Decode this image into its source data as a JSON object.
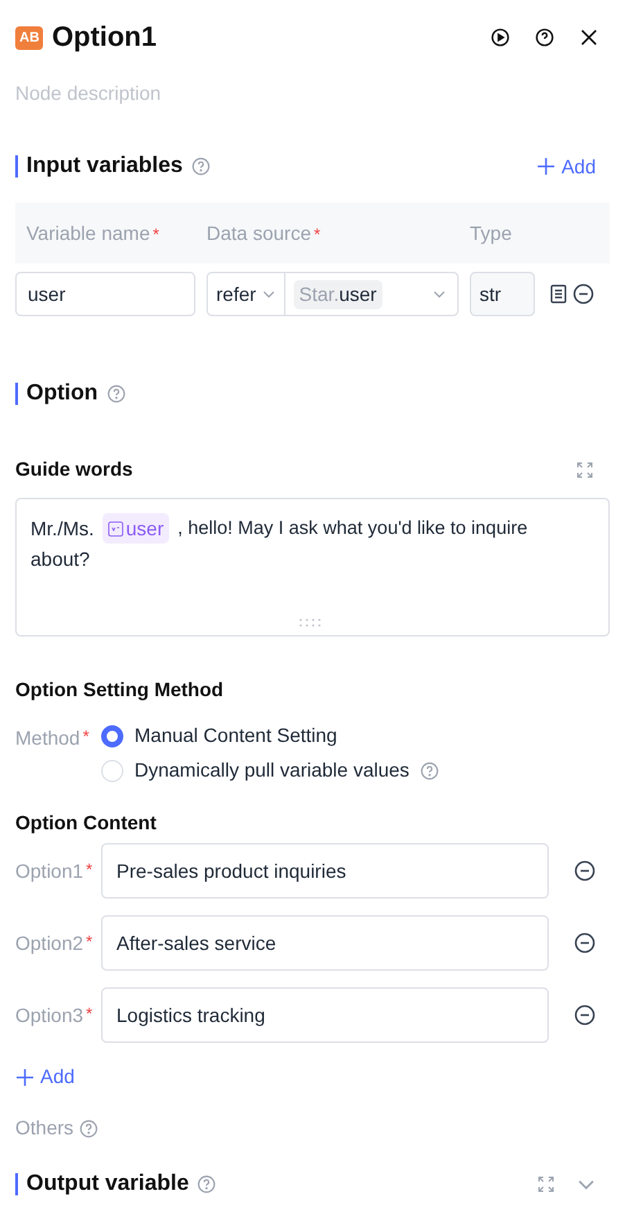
{
  "header": {
    "badge": "AB",
    "title": "Option1",
    "description_placeholder": "Node description"
  },
  "input_variables": {
    "title": "Input variables",
    "add": "Add",
    "columns": [
      {
        "label": "Variable name",
        "required_mark": "*"
      },
      {
        "label": "Data source",
        "required_mark": "*"
      },
      {
        "label": "Type"
      }
    ],
    "rows": [
      {
        "name": "user",
        "source_mode": "refer",
        "source_prefix": "Star.",
        "source_value": "user",
        "type": "str"
      }
    ]
  },
  "option": {
    "title": "Option",
    "guide_title": "Guide words",
    "guide_prefix": "Mr./Ms.",
    "guide_variable": "user",
    "guide_suffix": [
      ", hello! May I ask what you'd like to inquire",
      "about?"
    ],
    "method_title": "Option Setting Method",
    "method_label": "Method",
    "method_required_mark": "*",
    "methods": [
      {
        "label": "Manual Content Setting",
        "selected": true,
        "help": false
      },
      {
        "label": "Dynamically pull variable values",
        "selected": false,
        "help": true
      }
    ],
    "content_title": "Option Content",
    "options": [
      {
        "label": "Option1",
        "required_mark": "*",
        "value": "Pre-sales product inquiries"
      },
      {
        "label": "Option2",
        "required_mark": "*",
        "value": "After-sales service"
      },
      {
        "label": "Option3",
        "required_mark": "*",
        "value": "Logistics tracking"
      }
    ],
    "add": "Add",
    "others": "Others"
  },
  "output": {
    "title": "Output variable"
  }
}
